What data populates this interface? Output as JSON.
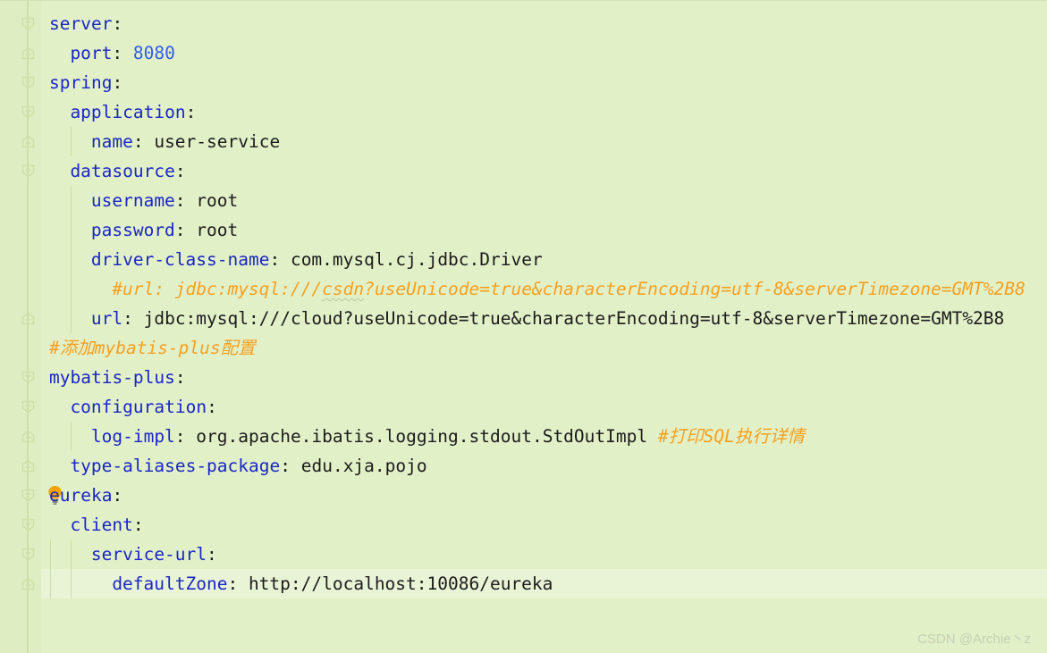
{
  "app": {
    "kind": "code-editor",
    "language": "yaml",
    "theme_background": "#e2f0c8",
    "gutter_background": "#dfeec2",
    "current_line_background": "#e9f3d6",
    "key_color": "#1a26c4",
    "value_color": "#1b1b1b",
    "number_color": "#2f5de8",
    "comment_color": "#f5a020"
  },
  "gutter": {
    "bulb_icon": "lightbulb-icon",
    "bulb_line": 17,
    "fold_markers": [
      {
        "line": 1,
        "type": "fold-start",
        "icon": "fold-collapse-icon"
      },
      {
        "line": 2,
        "type": "fold-end",
        "icon": "fold-end-icon"
      },
      {
        "line": 3,
        "type": "fold-start",
        "icon": "fold-collapse-icon"
      },
      {
        "line": 4,
        "type": "fold-start",
        "icon": "fold-collapse-icon"
      },
      {
        "line": 5,
        "type": "fold-end",
        "icon": "fold-end-icon"
      },
      {
        "line": 6,
        "type": "fold-start",
        "icon": "fold-collapse-icon"
      },
      {
        "line": 11,
        "type": "fold-end",
        "icon": "fold-end-icon"
      },
      {
        "line": 13,
        "type": "fold-start",
        "icon": "fold-collapse-icon"
      },
      {
        "line": 14,
        "type": "fold-start",
        "icon": "fold-collapse-icon"
      },
      {
        "line": 15,
        "type": "fold-end",
        "icon": "fold-end-icon"
      },
      {
        "line": 16,
        "type": "fold-end",
        "icon": "fold-end-icon"
      },
      {
        "line": 17,
        "type": "fold-start",
        "icon": "fold-collapse-icon"
      },
      {
        "line": 18,
        "type": "fold-start",
        "icon": "fold-collapse-icon"
      },
      {
        "line": 19,
        "type": "fold-start",
        "icon": "fold-collapse-icon"
      },
      {
        "line": 20,
        "type": "fold-end",
        "icon": "fold-end-icon"
      }
    ]
  },
  "code": {
    "lines": [
      {
        "n": 1,
        "indent": 0,
        "key": "server",
        "sep": ":",
        "value": ""
      },
      {
        "n": 2,
        "indent": 1,
        "key": "port",
        "sep": ": ",
        "value": "8080",
        "value_kind": "number"
      },
      {
        "n": 3,
        "indent": 0,
        "key": "spring",
        "sep": ":",
        "value": ""
      },
      {
        "n": 4,
        "indent": 1,
        "key": "application",
        "sep": ":",
        "value": ""
      },
      {
        "n": 5,
        "indent": 2,
        "key": "name",
        "sep": ": ",
        "value": "user-service"
      },
      {
        "n": 6,
        "indent": 1,
        "key": "datasource",
        "sep": ":",
        "value": ""
      },
      {
        "n": 7,
        "indent": 2,
        "key": "username",
        "sep": ": ",
        "value": "root"
      },
      {
        "n": 8,
        "indent": 2,
        "key": "password",
        "sep": ": ",
        "value": "root"
      },
      {
        "n": 9,
        "indent": 2,
        "key": "driver-class-name",
        "sep": ": ",
        "value": "com.mysql.cj.jdbc.Driver"
      },
      {
        "n": 10,
        "indent": 3,
        "kind": "comment",
        "comment_pre": "#url: jdbc:mysql:///",
        "comment_typo": "csdn",
        "comment_post": "?useUnicode=true&characterEncoding=utf-8&serverTimezone=GMT%2B8"
      },
      {
        "n": 11,
        "indent": 2,
        "key": "url",
        "sep": ": ",
        "value": "jdbc:mysql:///cloud?useUnicode=true&characterEncoding=utf-8&serverTimezone=GMT%2B8"
      },
      {
        "n": 12,
        "indent": 0,
        "kind": "comment",
        "comment_pre": "#添加mybatis-plus配置"
      },
      {
        "n": 13,
        "indent": 0,
        "key": "mybatis-plus",
        "sep": ":",
        "value": ""
      },
      {
        "n": 14,
        "indent": 1,
        "key": "configuration",
        "sep": ":",
        "value": ""
      },
      {
        "n": 15,
        "indent": 2,
        "key": "log-impl",
        "sep": ": ",
        "value": "org.apache.ibatis.logging.stdout.StdOutImpl",
        "trailing_comment": "#打印SQL执行详情"
      },
      {
        "n": 16,
        "indent": 1,
        "key": "type-aliases-package",
        "sep": ": ",
        "value": "edu.xja.pojo"
      },
      {
        "n": 17,
        "indent": 0,
        "key": "eureka",
        "sep": ":",
        "value": ""
      },
      {
        "n": 18,
        "indent": 1,
        "key": "client",
        "sep": ":",
        "value": ""
      },
      {
        "n": 19,
        "indent": 2,
        "key": "service-url",
        "sep": ":",
        "value": ""
      },
      {
        "n": 20,
        "indent": 3,
        "key": "defaultZone",
        "sep": ": ",
        "value": "http://localhost:10086/eureka"
      }
    ],
    "current_line": 20
  },
  "watermark": {
    "text": "CSDN @Archie丶z"
  }
}
